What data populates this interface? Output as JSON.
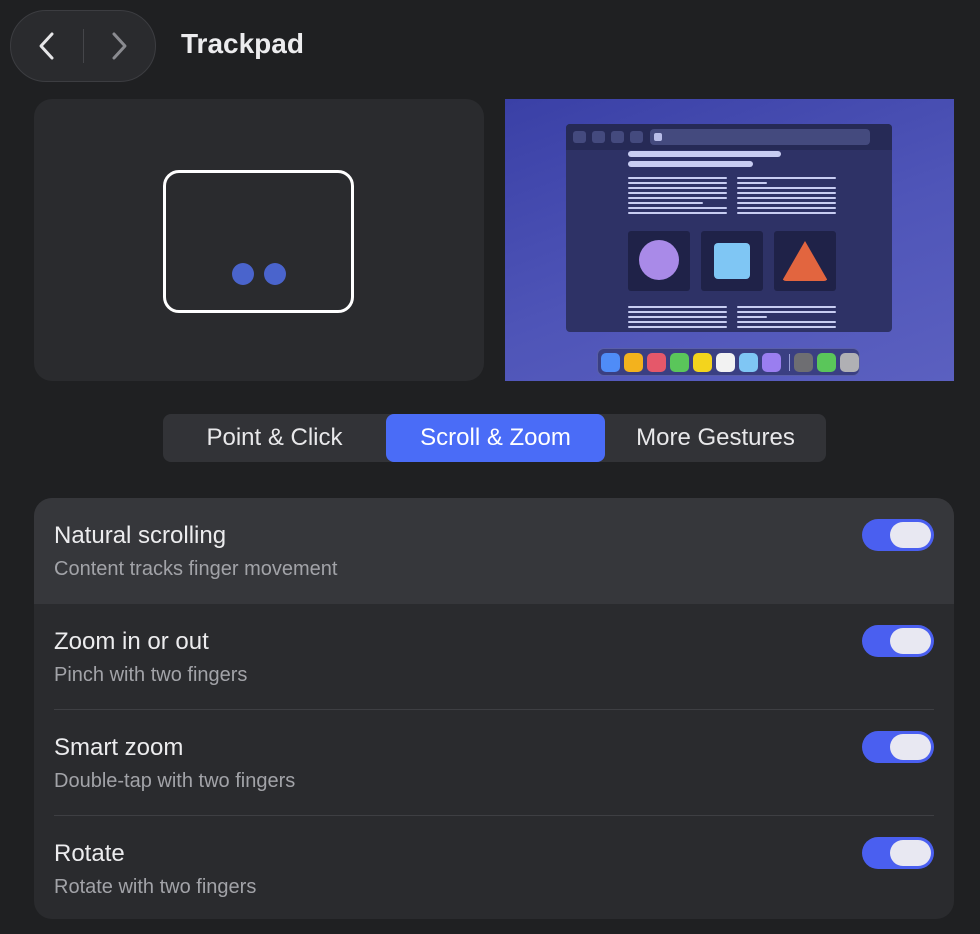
{
  "header": {
    "title": "Trackpad",
    "back_icon": "chevron-left-icon",
    "forward_icon": "chevron-right-icon"
  },
  "preview": {
    "gesture_fingers": 2,
    "finger_color": "#4a64cc",
    "background_color": "#3a40a6",
    "dock_icon_colors": [
      "#4f8cf7",
      "#f3b21d",
      "#e5586a",
      "#5ac65a",
      "#f3d41d",
      "#f2f2f2",
      "#7fc6f4",
      "#9a7ef0",
      "#6e6e72",
      "#5ac65a",
      "#b0b0b4"
    ]
  },
  "tabs": [
    {
      "label": "Point & Click",
      "selected": false
    },
    {
      "label": "Scroll & Zoom",
      "selected": true
    },
    {
      "label": "More Gestures",
      "selected": false
    }
  ],
  "settings": [
    {
      "title": "Natural scrolling",
      "subtitle": "Content tracks finger movement",
      "enabled": true
    },
    {
      "title": "Zoom in or out",
      "subtitle": "Pinch with two fingers",
      "enabled": true
    },
    {
      "title": "Smart zoom",
      "subtitle": "Double-tap with two fingers",
      "enabled": true
    },
    {
      "title": "Rotate",
      "subtitle": "Rotate with two fingers",
      "enabled": true
    }
  ],
  "colors": {
    "accent": "#4a6cf7",
    "toggle_on": "#4a5ff0",
    "window_bg": "#1f2022",
    "panel_bg": "#2a2b2e"
  }
}
